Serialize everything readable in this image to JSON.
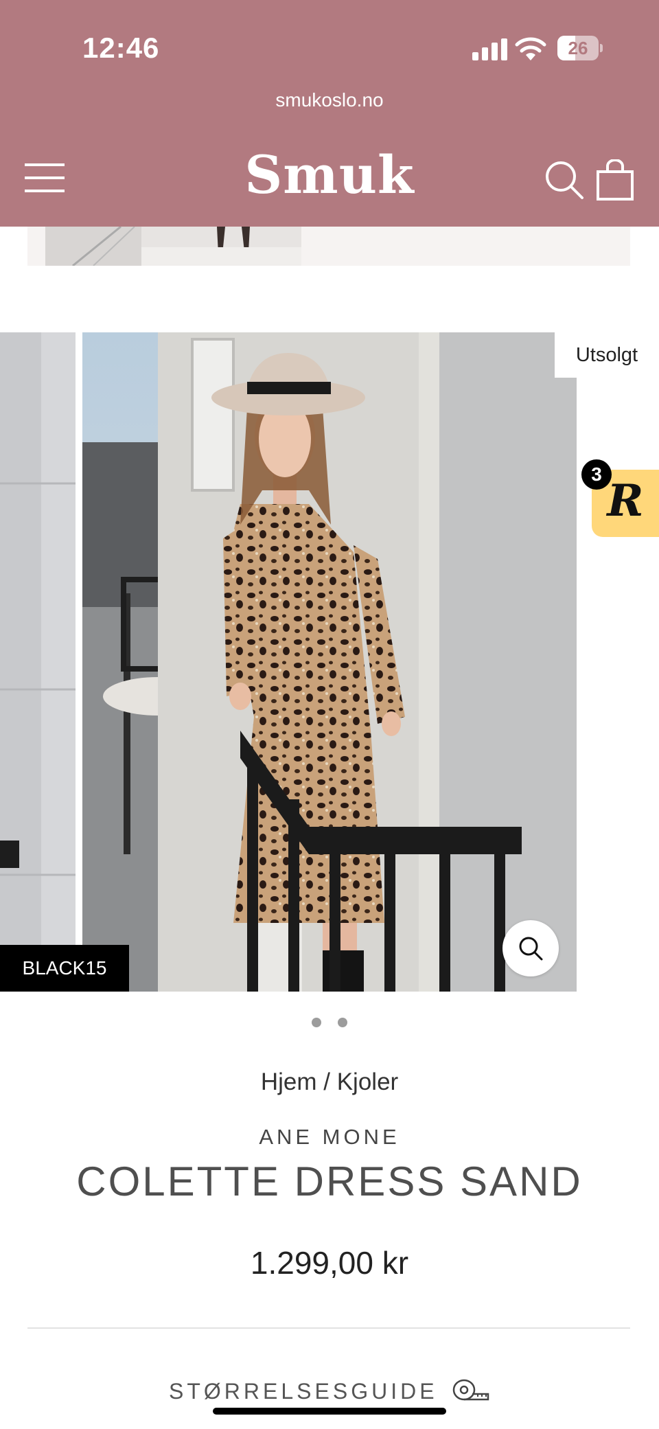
{
  "status_bar": {
    "time": "12:46",
    "battery": "26",
    "icons": [
      "cellular-signal-icon",
      "wifi-icon",
      "battery-icon"
    ]
  },
  "browser": {
    "url": "smukoslo.no"
  },
  "header": {
    "logo": "Smuk",
    "background": "#b27a80",
    "icons": [
      "hamburger-menu-icon",
      "search-icon",
      "shopping-bag-icon"
    ]
  },
  "gallery": {
    "sold_badge": "Utsolgt",
    "discount_code_badge": "BLACK15",
    "slide_count": 2,
    "icons": [
      "zoom-magnifier-icon"
    ]
  },
  "rewards_widget": {
    "count": "3",
    "glyph": "R"
  },
  "product": {
    "breadcrumb": {
      "home": "Hjem",
      "separator": "/",
      "category": "Kjoler"
    },
    "vendor": "ANE MONE",
    "title": "COLETTE DRESS SAND",
    "price": "1.299,00 kr",
    "size_guide": "STØRRELSESGUIDE",
    "size_guide_icon": "measuring-tape-icon"
  }
}
